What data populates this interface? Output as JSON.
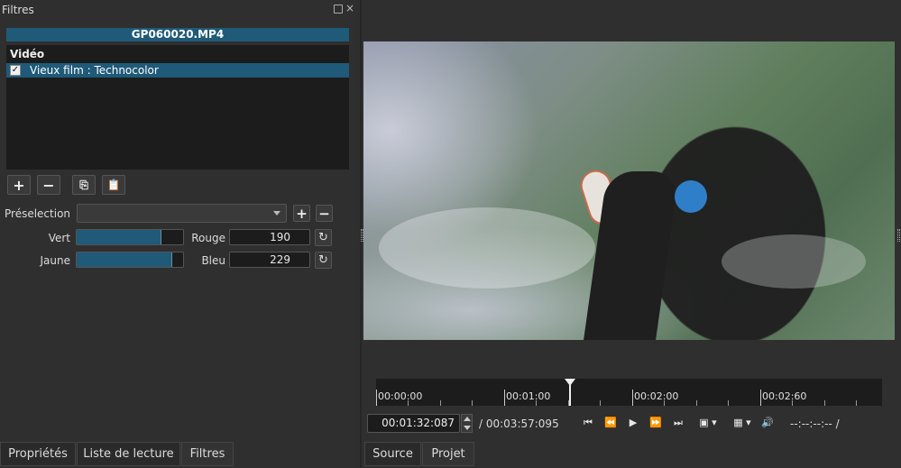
{
  "panel": {
    "title": "Filtres",
    "close_icon": "×",
    "clip_name": "GP060020.MP4",
    "list_header": "Vidéo",
    "filters": [
      {
        "label": "Vieux film : Technocolor",
        "checked": true,
        "check_glyph": "✓"
      }
    ],
    "toolbar": {
      "add": "+",
      "remove": "−",
      "copy": "⎘",
      "paste": "📋"
    }
  },
  "preset": {
    "label": "Préselection",
    "value": "",
    "add": "+",
    "remove": "−"
  },
  "params": {
    "vert": {
      "label": "Vert",
      "level": 0.8
    },
    "rouge": {
      "label": "Rouge",
      "value": "190"
    },
    "jaune": {
      "label": "Jaune",
      "level": 0.9
    },
    "bleu": {
      "label": "Bleu",
      "value": "229"
    },
    "reset_glyph": "↻"
  },
  "tabs_left": [
    "Propriétés",
    "Liste de lecture",
    "Filtres"
  ],
  "tabs_right": [
    "Source",
    "Projet"
  ],
  "ruler": {
    "labels": [
      "00:00:00",
      "00:01:00",
      "00:02:00",
      "00:02:60"
    ]
  },
  "transport": {
    "timecode": "00:01:32:087",
    "duration": "/ 00:03:57:095",
    "in_out": "--:--:--:-- /",
    "buttons": {
      "skip_start": "⏮",
      "rewind": "⏪",
      "play": "▶",
      "fast_forward": "⏩",
      "skip_end": "⏭",
      "zoom": "▣ ▾",
      "grid": "▦ ▾",
      "volume": "🔊"
    }
  },
  "colors": {
    "accent": "#1f5a78",
    "background": "#2f2f2f",
    "field": "#1c1c1c"
  }
}
